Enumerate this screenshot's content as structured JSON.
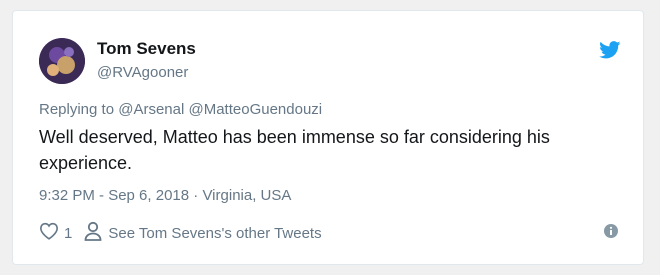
{
  "author": {
    "name": "Tom Sevens",
    "handle": "@RVAgooner"
  },
  "reply": {
    "prefix": "Replying to",
    "mentions": [
      "@Arsenal",
      "@MatteoGuendouzi"
    ]
  },
  "tweet": {
    "text": "Well deserved, Matteo has been immense so far considering his experience.",
    "timestamp": "9:32 PM - Sep 6, 2018",
    "separator": "·",
    "location": "Virginia, USA"
  },
  "actions": {
    "like_count": "1",
    "other_tweets_label": "See Tom Sevens's other Tweets"
  },
  "icons": {
    "brand": "twitter-bird-icon",
    "like": "heart-icon",
    "profile": "person-icon",
    "info": "info-icon"
  },
  "colors": {
    "twitter_blue": "#1da1f2",
    "text": "#14171a",
    "secondary": "#657786"
  }
}
